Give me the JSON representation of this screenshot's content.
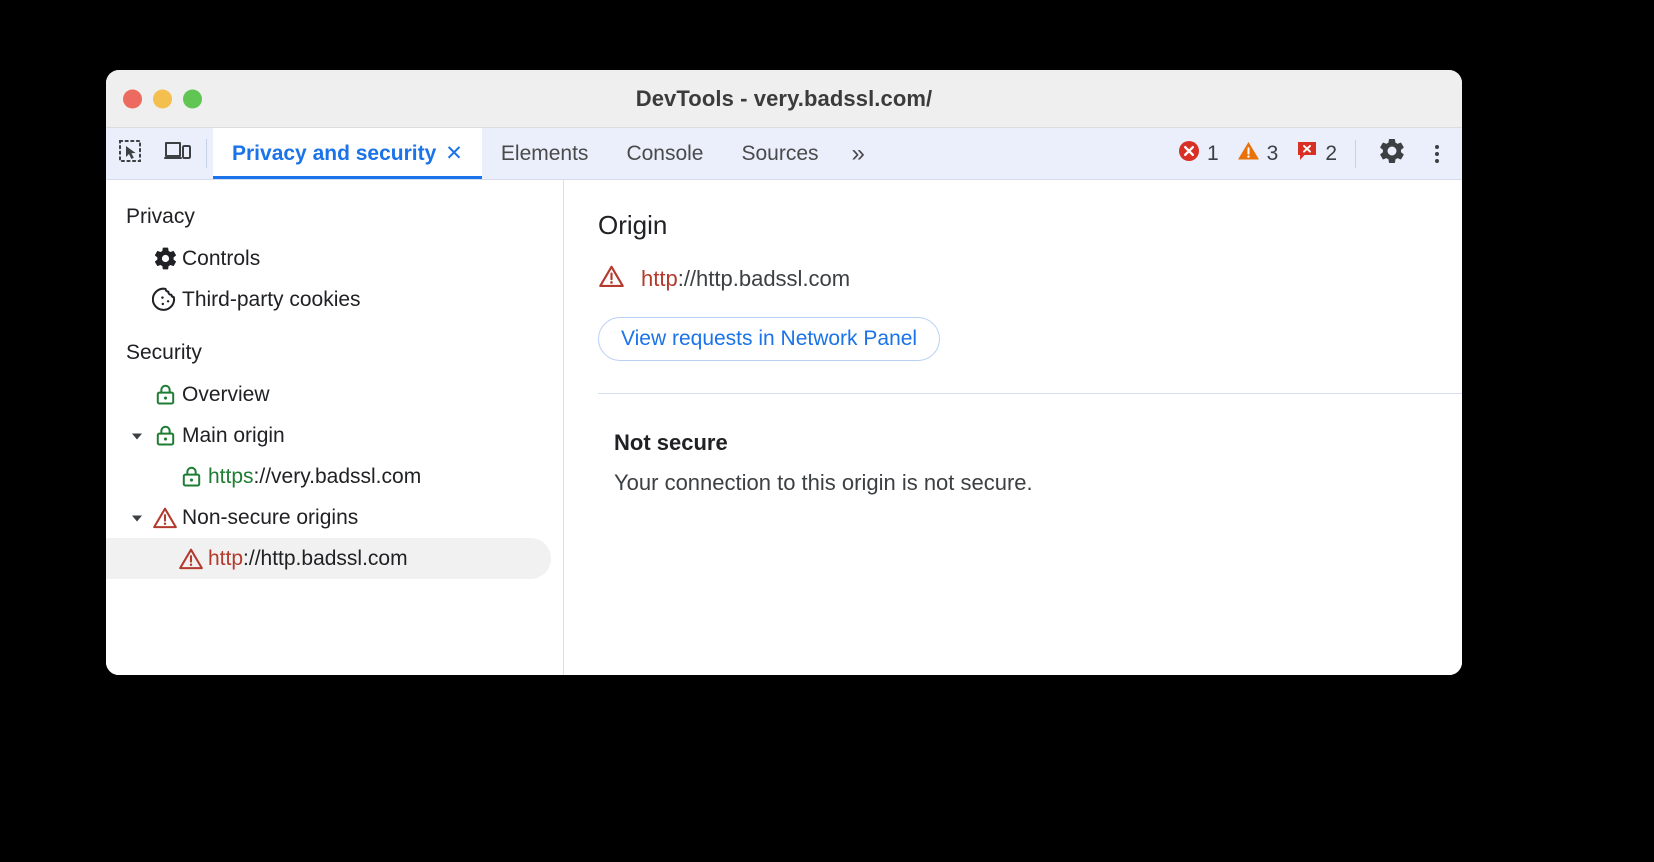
{
  "window": {
    "title": "DevTools - very.badssl.com/",
    "traffic_lights": [
      "close",
      "minimize",
      "zoom"
    ]
  },
  "toolbar": {
    "inspect_icon": "inspect-element-icon",
    "device_icon": "device-toolbar-icon",
    "overflow_label": "»",
    "settings_icon": "gear-icon",
    "more_icon": "kebab-menu-icon",
    "tabs": [
      {
        "label": "Privacy and security",
        "active": true,
        "closable": true,
        "close_label": "✕"
      },
      {
        "label": "Elements",
        "active": false,
        "closable": false
      },
      {
        "label": "Console",
        "active": false,
        "closable": false
      },
      {
        "label": "Sources",
        "active": false,
        "closable": false
      }
    ],
    "badges": [
      {
        "icon": "error-icon",
        "count": "1",
        "color": "#d93025"
      },
      {
        "icon": "warning-icon",
        "count": "3",
        "color": "#e8710a"
      },
      {
        "icon": "issue-icon",
        "count": "2",
        "color": "#d93025"
      }
    ]
  },
  "sidebar": {
    "sections": [
      {
        "heading": "Privacy",
        "items": [
          {
            "label": "Controls",
            "icon": "gear-icon",
            "indent": 1,
            "triangle": "none",
            "selected": false
          },
          {
            "label": "Third-party cookies",
            "icon": "cookie-icon",
            "indent": 1,
            "triangle": "none",
            "selected": false
          }
        ]
      },
      {
        "heading": "Security",
        "items": [
          {
            "label": "Overview",
            "icon": "lock-green-icon",
            "indent": 1,
            "triangle": "none",
            "selected": false
          },
          {
            "label": "Main origin",
            "icon": "lock-green-icon",
            "indent": 1,
            "triangle": "expanded",
            "selected": false
          },
          {
            "label": "https://very.badssl.com",
            "scheme": "https",
            "rest": "://very.badssl.com",
            "scheme_color": "green",
            "icon": "lock-green-icon",
            "indent": 2,
            "triangle": "none",
            "selected": false
          },
          {
            "label": "Non-secure origins",
            "icon": "warning-red-icon",
            "indent": 1,
            "triangle": "expanded",
            "selected": false
          },
          {
            "label": "http://http.badssl.com",
            "scheme": "http",
            "rest": "://http.badssl.com",
            "scheme_color": "red",
            "icon": "warning-red-icon",
            "indent": 2,
            "triangle": "none",
            "selected": true
          }
        ]
      }
    ]
  },
  "main": {
    "origin_heading": "Origin",
    "origin_icon": "warning-red-icon",
    "origin_scheme": "http",
    "origin_rest": "://http.badssl.com",
    "network_button_label": "View requests in Network Panel",
    "status_title": "Not secure",
    "status_description": "Your connection to this origin is not secure."
  },
  "colors": {
    "accent_blue": "#1a73e8",
    "secure_green": "#1e7c33",
    "insecure_red": "#b33a2d",
    "error_red": "#d93025",
    "warning_orange": "#e8710a",
    "tabbar_bg": "#eaeffb",
    "titlebar_bg": "#efefef"
  }
}
